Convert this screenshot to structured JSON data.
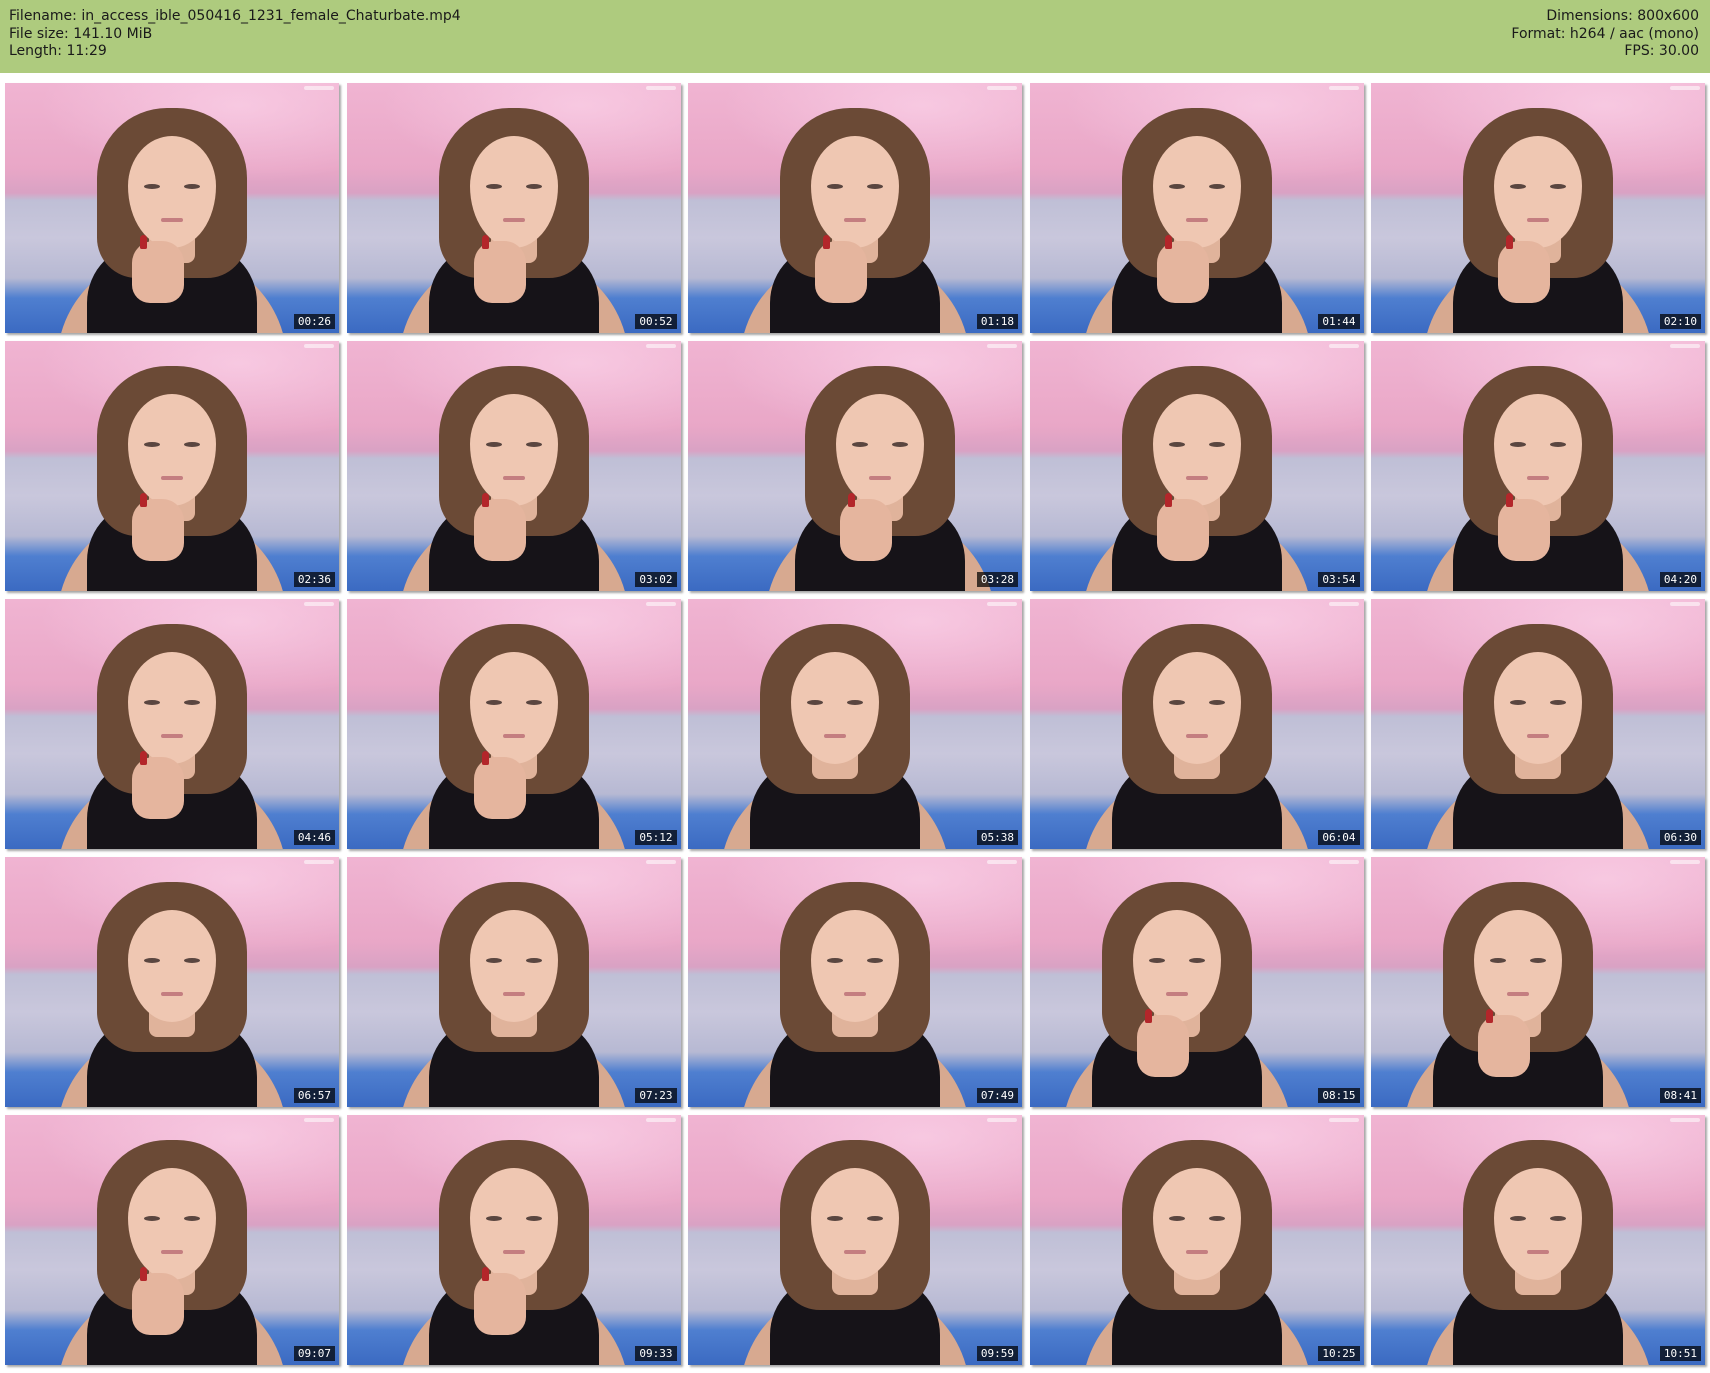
{
  "header": {
    "filename_label": "Filename:",
    "filename": "in_access_ible_050416_1231_female_Chaturbate.mp4",
    "filesize_label": "File size:",
    "filesize": "141.10 MiB",
    "length_label": "Length:",
    "length": "11:29",
    "dimensions_label": "Dimensions:",
    "dimensions": "800x600",
    "format_label": "Format:",
    "format": "h264 / aac (mono)",
    "fps_label": "FPS:",
    "fps": "30.00"
  },
  "thumbnails": [
    {
      "timestamp": "00:26"
    },
    {
      "timestamp": "00:52"
    },
    {
      "timestamp": "01:18"
    },
    {
      "timestamp": "01:44"
    },
    {
      "timestamp": "02:10"
    },
    {
      "timestamp": "02:36"
    },
    {
      "timestamp": "03:02"
    },
    {
      "timestamp": "03:28"
    },
    {
      "timestamp": "03:54"
    },
    {
      "timestamp": "04:20"
    },
    {
      "timestamp": "04:46"
    },
    {
      "timestamp": "05:12"
    },
    {
      "timestamp": "05:38"
    },
    {
      "timestamp": "06:04"
    },
    {
      "timestamp": "06:30"
    },
    {
      "timestamp": "06:57"
    },
    {
      "timestamp": "07:23"
    },
    {
      "timestamp": "07:49"
    },
    {
      "timestamp": "08:15"
    },
    {
      "timestamp": "08:41"
    },
    {
      "timestamp": "09:07"
    },
    {
      "timestamp": "09:33"
    },
    {
      "timestamp": "09:59"
    },
    {
      "timestamp": "10:25"
    },
    {
      "timestamp": "10:51"
    }
  ],
  "colors": {
    "header_bg": "#aecb7e",
    "timestamp_bg": "#000000",
    "timestamp_text": "#ffffff"
  }
}
